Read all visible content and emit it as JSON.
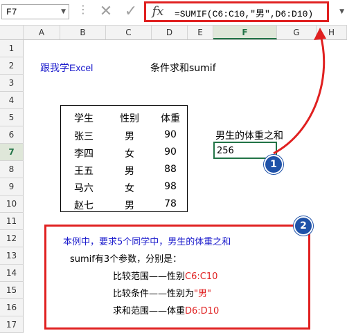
{
  "formula_bar": {
    "name_box": "F7",
    "cancel_glyph": "✕",
    "enter_glyph": "✓",
    "fx_label": "fx",
    "formula_prefix": "=SUMIF(C6:C10,",
    "formula_quoted": "\"男\"",
    "formula_suffix": ",D6:D10)"
  },
  "columns": [
    "A",
    "B",
    "C",
    "D",
    "E",
    "F",
    "G",
    "H"
  ],
  "rows": [
    "1",
    "2",
    "3",
    "4",
    "5",
    "6",
    "7",
    "8",
    "9",
    "10",
    "11",
    "12",
    "13",
    "14",
    "15",
    "16",
    "17"
  ],
  "cells": {
    "b2": "跟我学Excel",
    "d2": "条件求和sumif",
    "f6": "男生的体重之和",
    "f7": "256"
  },
  "table": {
    "headers": [
      "学生",
      "性别",
      "体重"
    ],
    "rows": [
      [
        "张三",
        "男",
        "90"
      ],
      [
        "李四",
        "女",
        "90"
      ],
      [
        "王五",
        "男",
        "88"
      ],
      [
        "马六",
        "女",
        "98"
      ],
      [
        "赵七",
        "男",
        "78"
      ]
    ]
  },
  "annotation": {
    "line1": "本例中，要求5个同学中，男生的体重之和",
    "line2": "sumif有3个参数，分别是：",
    "line3_a": "比较范围——性别",
    "line3_b": "C6:C10",
    "line4_a": "比较条件——性别为",
    "line4_b": "\"男\"",
    "line5_a": "求和范围——体重",
    "line5_b": "D6:D10"
  },
  "badges": [
    "1",
    "2"
  ],
  "colors": {
    "accent_red": "#e02020",
    "excel_green": "#217346",
    "blue_text": "#1a1acc",
    "badge_blue": "#1f52a8"
  }
}
